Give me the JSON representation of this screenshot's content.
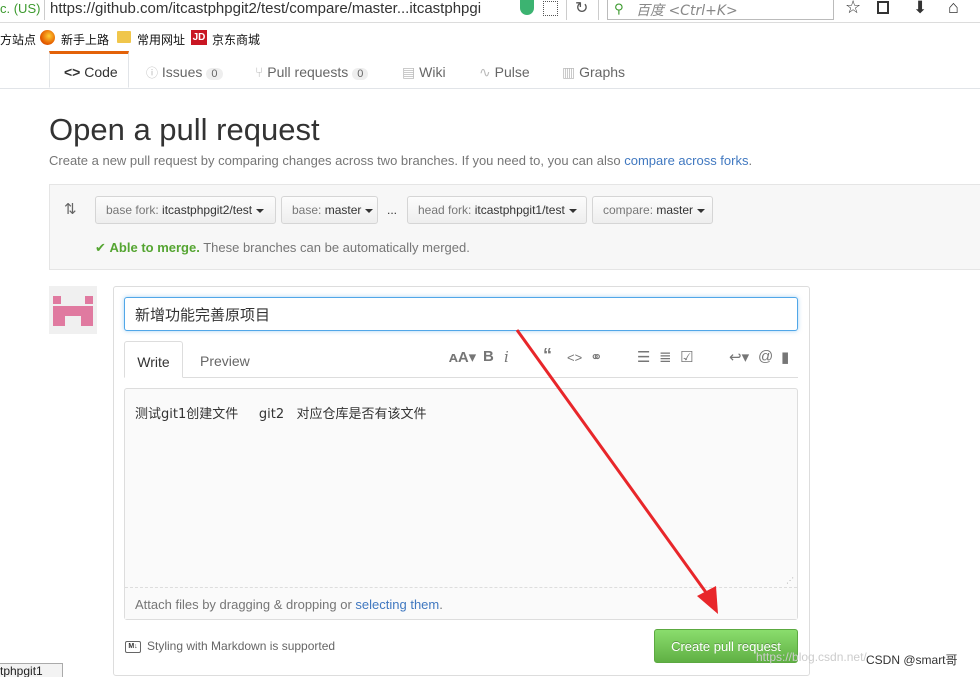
{
  "browser": {
    "cert_label": "c. (US)",
    "url": "https://github.com/itcastphpgit2/test/compare/master...itcastphpgi",
    "search_placeholder": "百度 <Ctrl+K>",
    "bookmarks": [
      "方站点",
      "新手上路",
      "常用网址",
      "京东商城"
    ]
  },
  "repo_nav": {
    "tabs": [
      {
        "label": "Code"
      },
      {
        "label": "Issues",
        "count": "0"
      },
      {
        "label": "Pull requests",
        "count": "0"
      },
      {
        "label": "Wiki"
      },
      {
        "label": "Pulse"
      },
      {
        "label": "Graphs"
      }
    ]
  },
  "page": {
    "title": "Open a pull request",
    "description": "Create a new pull request by comparing changes across two branches. If you need to, you can also ",
    "description_link": "compare across forks",
    "description_end": "."
  },
  "compare": {
    "base_fork_label": "base fork:",
    "base_fork_value": "itcastphpgit2/test",
    "base_label": "base:",
    "base_value": "master",
    "ellipsis": "...",
    "head_fork_label": "head fork:",
    "head_fork_value": "itcastphpgit1/test",
    "compare_label": "compare:",
    "compare_value": "master",
    "merge_status": "Able to merge.",
    "merge_note": " These branches can be automatically merged."
  },
  "form": {
    "title_value": "新增功能完善原项目",
    "tab_write": "Write",
    "tab_preview": "Preview",
    "body_value": "测试git1创建文件     git2   对应仓库是否有该文件",
    "attach_text": "Attach files by dragging & dropping or ",
    "attach_link": "selecting them",
    "attach_end": ".",
    "markdown_note": "Styling with Markdown is supported",
    "create_button": "Create pull request"
  },
  "status_tip": "tphpgit1",
  "watermark": "CSDN @smart哥",
  "watermark_faint": "https://blog.csdn.net/"
}
